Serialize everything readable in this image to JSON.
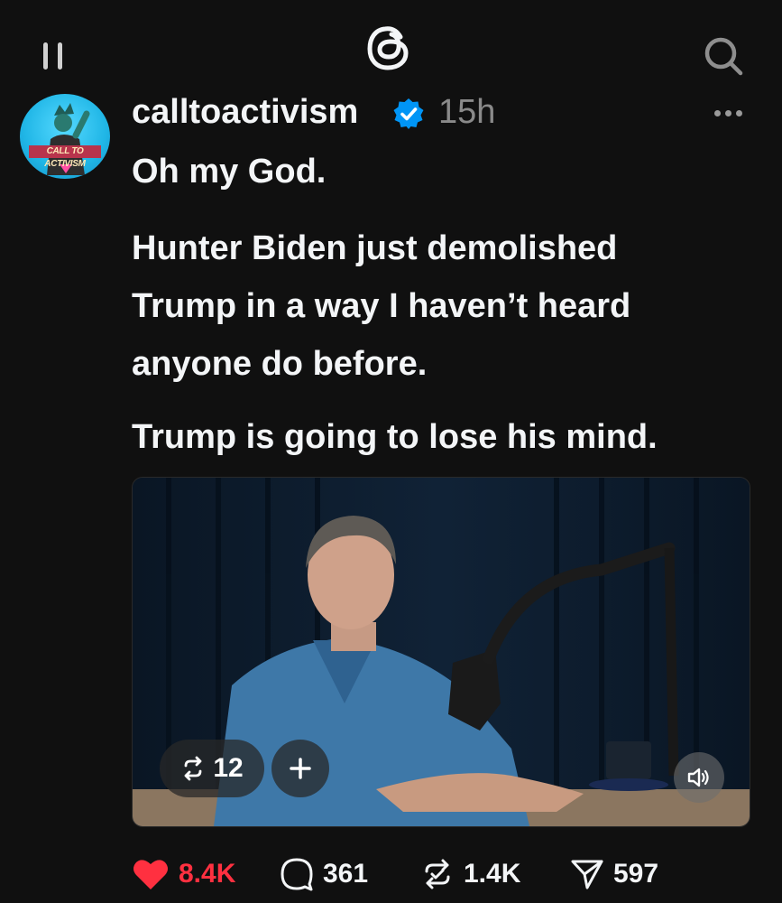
{
  "header": {
    "menu_icon": "menu-icon",
    "logo_icon": "threads-logo",
    "search_icon": "search-icon"
  },
  "post": {
    "author": "calltoactivism",
    "avatar_text": "CALL TO ACTIVISM",
    "verified": true,
    "time": "15h",
    "lines": [
      "Oh my God.",
      "Hunter Biden just demolished",
      "Trump in a way I haven’t heard",
      "anyone do before.",
      "Trump is going to lose his mind."
    ],
    "media": {
      "repost_count": "12",
      "plus_icon": "plus-icon",
      "volume_icon": "volume-icon"
    },
    "actions": {
      "likes": "8.4K",
      "replies": "361",
      "reposts": "1.4K",
      "shares": "597"
    }
  },
  "colors": {
    "background": "#101010",
    "text": "#f3f5f7",
    "muted": "#8a8a8a",
    "like": "#ff3040",
    "verified": "#0095f6"
  }
}
